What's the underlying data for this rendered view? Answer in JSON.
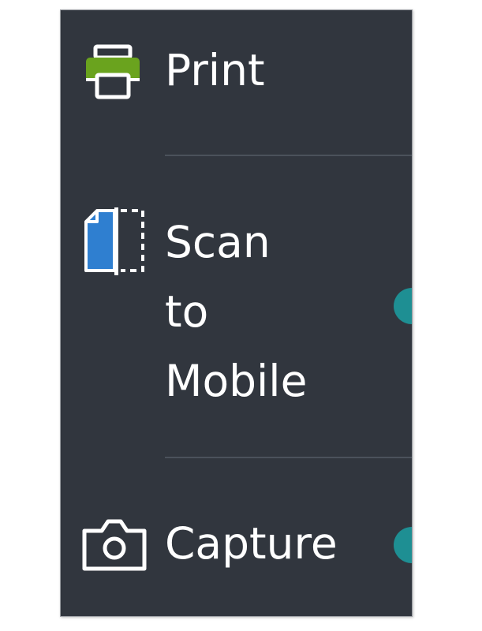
{
  "menu": {
    "items": [
      {
        "id": "print",
        "label": "Print",
        "icon": "printer-icon"
      },
      {
        "id": "scan",
        "label": "Scan\nto\nMobile",
        "icon": "scan-document-icon"
      },
      {
        "id": "capture",
        "label": "Capture",
        "icon": "camera-icon"
      }
    ]
  },
  "colors": {
    "panel_background": "#31363e",
    "divider": "#4b525b",
    "printer_accent": "#6aa31e",
    "scan_accent": "#2f7fd0",
    "indicator": "#1e8f93"
  }
}
